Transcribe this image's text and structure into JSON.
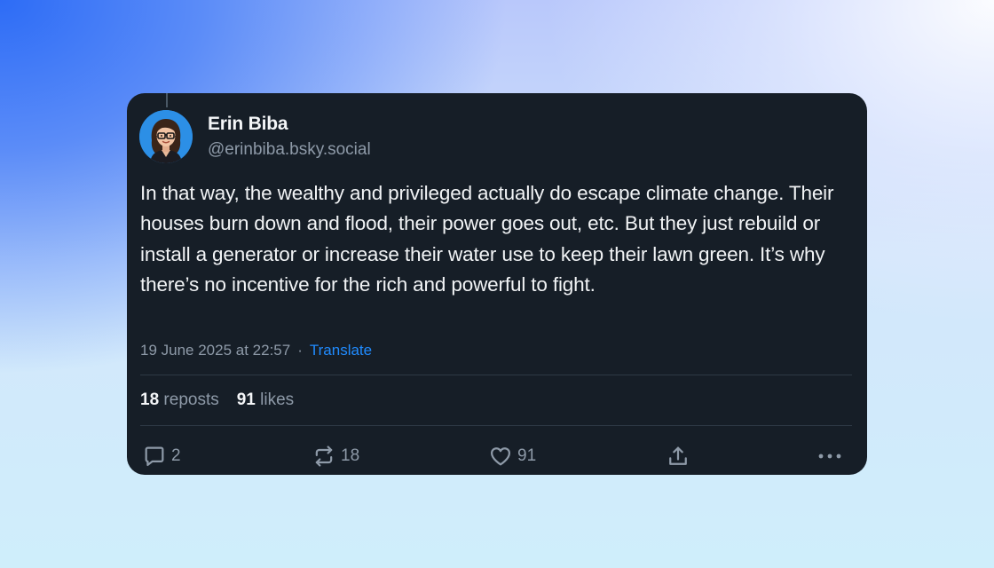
{
  "post": {
    "author": {
      "display_name": "Erin Biba",
      "handle": "@erinbiba.bsky.social",
      "avatar": "avatar-illustration"
    },
    "text": "In that way, the wealthy and privileged actually do escape climate change. Their houses burn down and flood, their power goes out, etc. But they just rebuild or install a generator or increase their water use to keep their lawn green. It’s why there’s no incentive for the rich and powerful to fight.",
    "timestamp": "19 June 2025 at 22:57",
    "separator": "·",
    "translate_label": "Translate",
    "stats": {
      "reposts_count": "18",
      "reposts_label": "reposts",
      "likes_count": "91",
      "likes_label": "likes"
    },
    "actions": {
      "reply": {
        "icon": "reply-icon",
        "count": "2"
      },
      "repost": {
        "icon": "repost-icon",
        "count": "18"
      },
      "like": {
        "icon": "heart-icon",
        "count": "91"
      },
      "share": {
        "icon": "share-icon"
      },
      "more": {
        "icon": "more-icon"
      }
    }
  },
  "colors": {
    "card_background": "#161e27",
    "text_primary": "#f1f3f5",
    "text_secondary": "#8e9aa8",
    "accent": "#208bfe",
    "avatar_background": "#2c8fe6"
  }
}
